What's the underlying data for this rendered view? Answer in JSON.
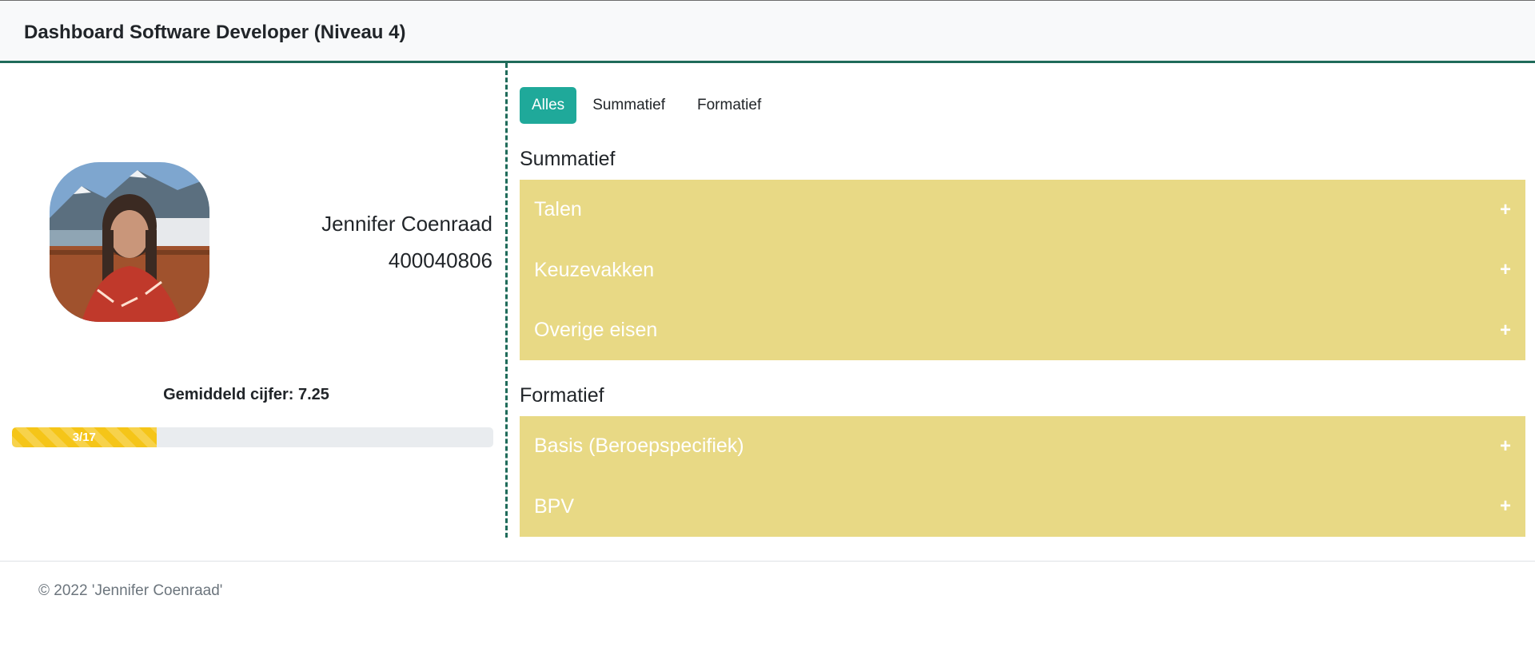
{
  "header": {
    "title": "Dashboard Software Developer (Niveau 4)"
  },
  "student": {
    "name": "Jennifer Coenraad",
    "number": "400040806",
    "average_label": "Gemiddeld cijfer:",
    "average_value": "7.25",
    "progress_label": "3/17",
    "progress_fraction": 0.3,
    "progress_color": "#f5c518"
  },
  "filter_tabs": [
    {
      "label": "Alles",
      "active": true
    },
    {
      "label": "Summatief",
      "active": false
    },
    {
      "label": "Formatief",
      "active": false
    }
  ],
  "summatief": {
    "heading": "Summatief",
    "items": [
      "Talen",
      "Keuzevakken",
      "Overige eisen"
    ]
  },
  "formatief": {
    "heading": "Formatief",
    "items": [
      "Basis (Beroepspecifiek)",
      "BPV"
    ]
  },
  "accordion_expand_symbol": "+",
  "footer": {
    "text": "© 2022 'Jennifer Coenraad'"
  },
  "colors": {
    "accent": "#1fa99a",
    "header_border": "#1f6b5a",
    "accordion_bg": "#e8d985"
  },
  "icons": {
    "avatar": "student-photo"
  }
}
